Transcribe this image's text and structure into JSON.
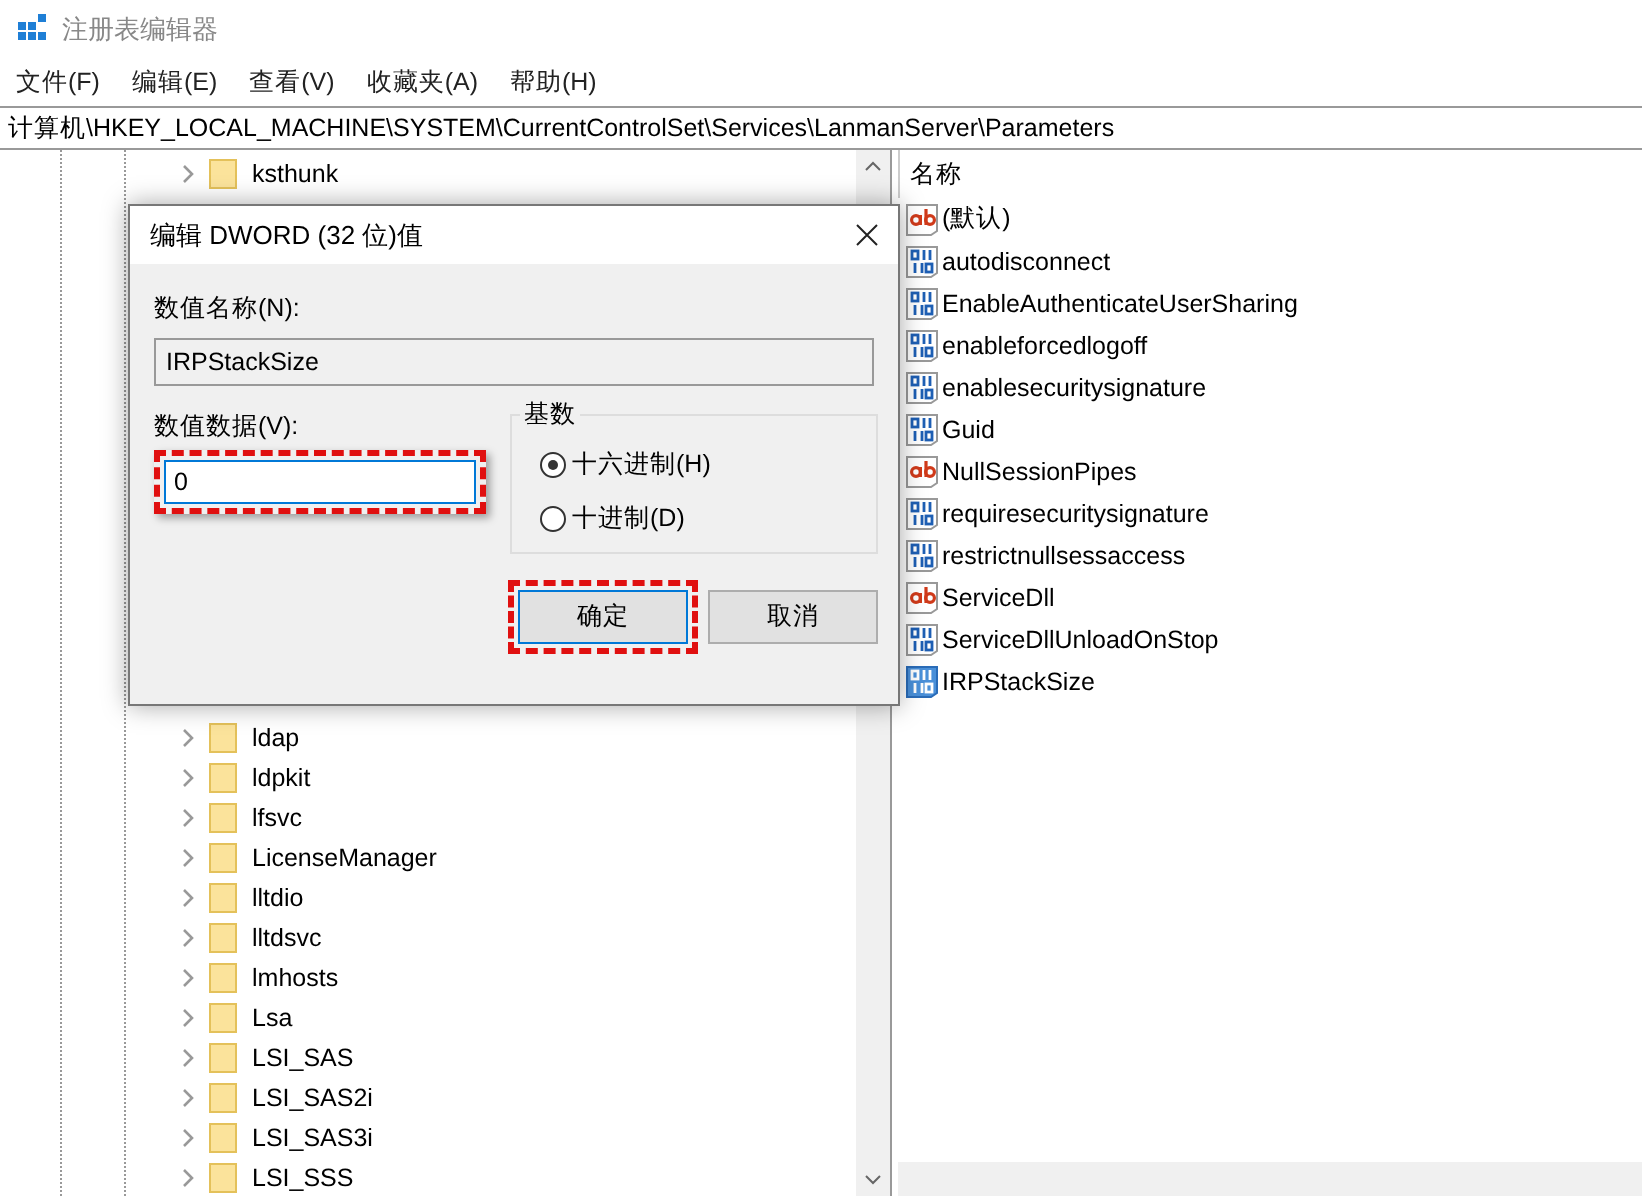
{
  "window": {
    "title": "注册表编辑器"
  },
  "menu": [
    "文件(F)",
    "编辑(E)",
    "查看(V)",
    "收藏夹(A)",
    "帮助(H)"
  ],
  "address": "计算机\\HKEY_LOCAL_MACHINE\\SYSTEM\\CurrentControlSet\\Services\\LanmanServer\\Parameters",
  "tree_top": [
    {
      "name": "ksthunk",
      "expanded": false
    }
  ],
  "tree_bottom": [
    {
      "name": "ldap",
      "expanded": false
    },
    {
      "name": "ldpkit",
      "expanded": false
    },
    {
      "name": "lfsvc",
      "expanded": false
    },
    {
      "name": "LicenseManager",
      "expanded": false
    },
    {
      "name": "lltdio",
      "expanded": false
    },
    {
      "name": "lltdsvc",
      "expanded": false
    },
    {
      "name": "lmhosts",
      "expanded": false
    },
    {
      "name": "Lsa",
      "expanded": false
    },
    {
      "name": "LSI_SAS",
      "expanded": false
    },
    {
      "name": "LSI_SAS2i",
      "expanded": false
    },
    {
      "name": "LSI_SAS3i",
      "expanded": false
    },
    {
      "name": "LSI_SSS",
      "expanded": false
    }
  ],
  "values": {
    "column": "名称",
    "items": [
      {
        "name": "(默认)",
        "kind": "string",
        "selected": false
      },
      {
        "name": "autodisconnect",
        "kind": "dword",
        "selected": false
      },
      {
        "name": "EnableAuthenticateUserSharing",
        "kind": "dword",
        "selected": false
      },
      {
        "name": "enableforcedlogoff",
        "kind": "dword",
        "selected": false
      },
      {
        "name": "enablesecuritysignature",
        "kind": "dword",
        "selected": false
      },
      {
        "name": "Guid",
        "kind": "dword",
        "selected": false
      },
      {
        "name": "NullSessionPipes",
        "kind": "string",
        "selected": false
      },
      {
        "name": "requiresecuritysignature",
        "kind": "dword",
        "selected": false
      },
      {
        "name": "restrictnullsessaccess",
        "kind": "dword",
        "selected": false
      },
      {
        "name": "ServiceDll",
        "kind": "string",
        "selected": false
      },
      {
        "name": "ServiceDllUnloadOnStop",
        "kind": "dword",
        "selected": false
      },
      {
        "name": "IRPStackSize",
        "kind": "dword",
        "selected": true
      }
    ]
  },
  "dialog": {
    "title": "编辑 DWORD (32 位)值",
    "name_label": "数值名称(N):",
    "name_value": "IRPStackSize",
    "data_label": "数值数据(V):",
    "data_value": "0",
    "data_highlighted": true,
    "base_label": "基数",
    "radios": [
      {
        "label": "十六进制(H)",
        "selected": true
      },
      {
        "label": "十进制(D)",
        "selected": false
      }
    ],
    "buttons": [
      {
        "label": "确定",
        "highlighted": true
      },
      {
        "label": "取消",
        "highlighted": false
      }
    ]
  }
}
